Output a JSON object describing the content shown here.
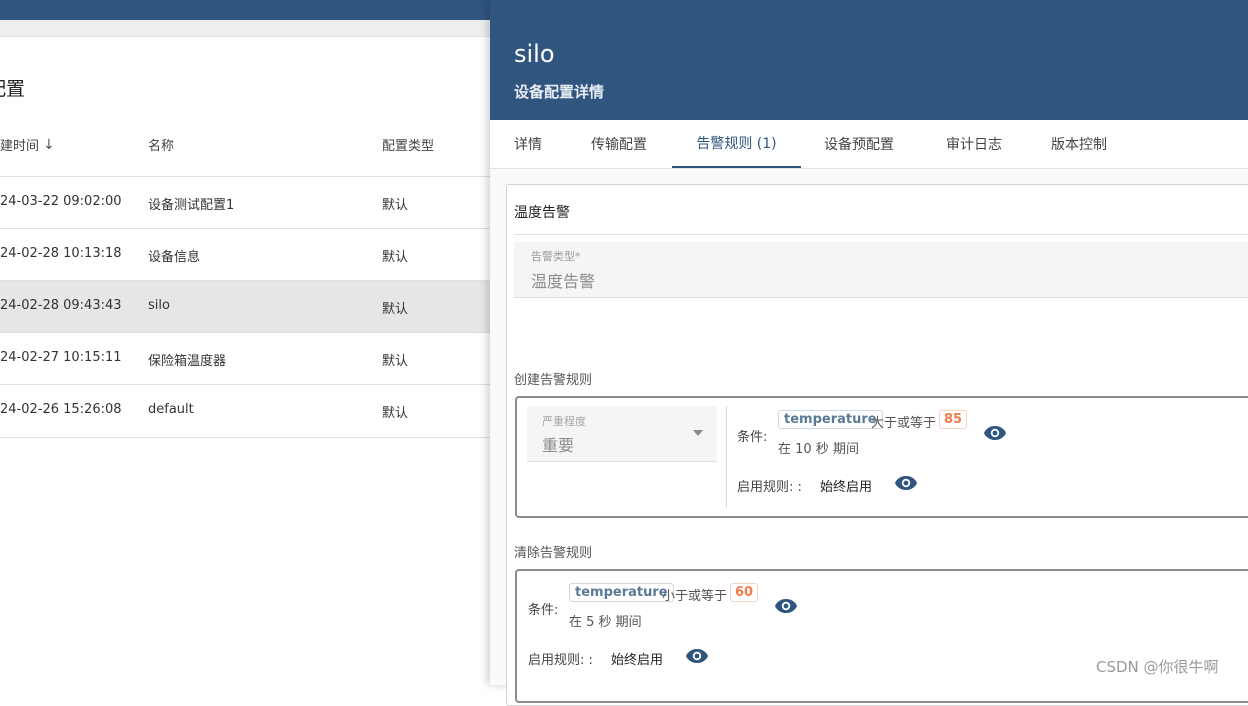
{
  "left_list": {
    "title": "配置",
    "columns": {
      "created": "建时间",
      "name": "名称",
      "type": "配置类型"
    },
    "rows": [
      {
        "created": "24-03-22 09:02:00",
        "name": "设备测试配置1",
        "type": "默认",
        "selected": false
      },
      {
        "created": "24-02-28 10:13:18",
        "name": "设备信息",
        "type": "默认",
        "selected": false
      },
      {
        "created": "24-02-28 09:43:43",
        "name": "silo",
        "type": "默认",
        "selected": true
      },
      {
        "created": "24-02-27 10:15:11",
        "name": "保险箱温度器",
        "type": "默认",
        "selected": false
      },
      {
        "created": "24-02-26 15:26:08",
        "name": "default",
        "type": "默认",
        "selected": false
      }
    ]
  },
  "drawer": {
    "title": "silo",
    "subtitle": "设备配置详情",
    "tabs": [
      "详情",
      "传输配置",
      "告警规则 (1)",
      "设备预配置",
      "审计日志",
      "版本控制"
    ],
    "active_tab": 2,
    "alarm": {
      "name": "温度告警",
      "type_label": "告警类型*",
      "type_value": "温度告警",
      "create_section": "创建告警规则",
      "create_rule": {
        "severity_label": "严重程度",
        "severity_value": "重要",
        "cond_label": "条件:",
        "key": "temperature",
        "op": "大于或等于",
        "value": "85",
        "duration": "在 10 秒 期间",
        "schedule_label": "启用规则: :",
        "schedule_value": "始终启用"
      },
      "clear_section": "清除告警规则",
      "clear_rule": {
        "cond_label": "条件:",
        "key": "temperature",
        "op": "小于或等于",
        "value": "60",
        "duration": "在 5 秒 期间",
        "schedule_label": "启用规则: :",
        "schedule_value": "始终启用"
      }
    }
  },
  "watermark": "CSDN @你很牛啊",
  "colors": {
    "primary": "#305680",
    "value_chip": "#ef7b4d",
    "key_chip": "#5a7a97"
  }
}
